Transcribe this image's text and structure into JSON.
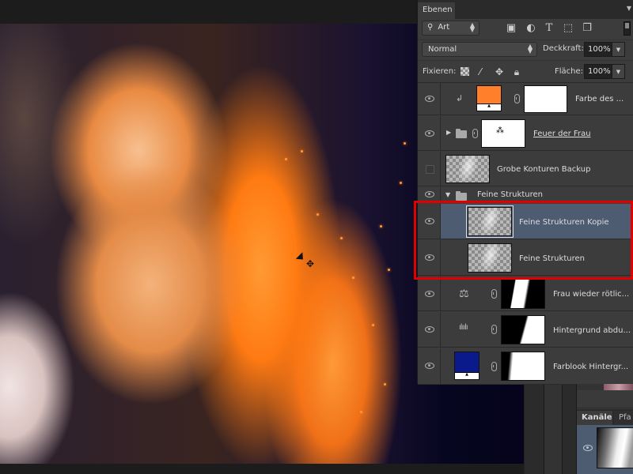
{
  "layers_panel": {
    "tab_label": "Ebenen",
    "filter": {
      "icon": "search-icon",
      "value": "Art"
    },
    "filter_icons": [
      "image-filter-icon",
      "adjustment-filter-icon",
      "type-filter-icon",
      "shape-filter-icon",
      "smart-object-filter-icon"
    ],
    "filter_icon_glyphs": [
      "▣",
      "◐",
      "T",
      "⬚",
      "❐"
    ],
    "blend_mode": "Normal",
    "opacity_label": "Deckkraft:",
    "opacity_value": "100%",
    "lock_label": "Fixieren:",
    "fill_label": "Fläche:",
    "fill_value": "100%",
    "layers": [
      {
        "name": "Farbe des ...",
        "visible": true,
        "type": "color-fill-clipped",
        "fill_color": "#ff7f2a"
      },
      {
        "name": "Feuer der Frau",
        "visible": true,
        "type": "group-with-mask",
        "collapsed": true
      },
      {
        "name": "Grobe Konturen Backup",
        "visible": false,
        "type": "pixel"
      },
      {
        "name": "Feine Strukturen",
        "visible": true,
        "type": "group",
        "expanded": true
      },
      {
        "name": "Feine Strukturen Kopie",
        "visible": true,
        "type": "pixel",
        "selected": true
      },
      {
        "name": "Feine Strukturen",
        "visible": true,
        "type": "pixel"
      },
      {
        "name": "Frau wieder rötlic...",
        "visible": true,
        "type": "color-balance-adjustment"
      },
      {
        "name": "Hintergrund abdu...",
        "visible": true,
        "type": "levels-adjustment"
      },
      {
        "name": "Farblook Hintergr...",
        "visible": true,
        "type": "color-fill",
        "fill_color": "#0a1a8a"
      }
    ]
  },
  "channels_panel": {
    "tabs": [
      "Kanäle",
      "Pfa"
    ]
  },
  "highlight_color": "#e10000",
  "selection_color": "#4e5c72"
}
